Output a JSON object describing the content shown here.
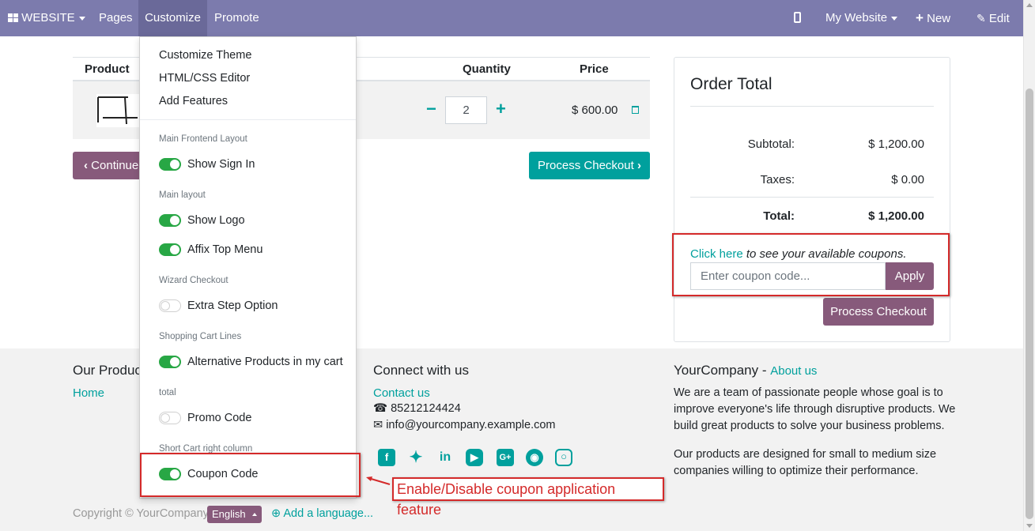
{
  "topbar": {
    "website_label": "WEBSITE",
    "pages": "Pages",
    "customize": "Customize",
    "promote": "Promote",
    "my_website": "My Website",
    "new": "New",
    "edit": "Edit",
    "bg_color": "#7c7bad"
  },
  "dropdown": {
    "items": [
      "Customize Theme",
      "HTML/CSS Editor",
      "Add Features"
    ],
    "sections": [
      {
        "header": "Main Frontend Layout",
        "options": [
          {
            "label": "Show Sign In",
            "enabled": true
          }
        ]
      },
      {
        "header": "Main layout",
        "options": [
          {
            "label": "Show Logo",
            "enabled": true
          },
          {
            "label": "Affix Top Menu",
            "enabled": true
          }
        ]
      },
      {
        "header": "Wizard Checkout",
        "options": [
          {
            "label": "Extra Step Option",
            "enabled": false
          }
        ]
      },
      {
        "header": "Shopping Cart Lines",
        "options": [
          {
            "label": "Alternative Products in my cart",
            "enabled": true
          }
        ]
      },
      {
        "header": "total",
        "options": [
          {
            "label": "Promo Code",
            "enabled": false
          }
        ]
      },
      {
        "header": "Short Cart right column",
        "options": [
          {
            "label": "Coupon Code",
            "enabled": true
          }
        ]
      }
    ]
  },
  "cart": {
    "headers": {
      "product": "Product",
      "quantity": "Quantity",
      "price": "Price"
    },
    "row": {
      "quantity": "2",
      "price": "$ 600.00"
    },
    "continue_label": "Continue",
    "checkout_label": "Process Checkout"
  },
  "order": {
    "title": "Order Total",
    "subtotal_label": "Subtotal:",
    "subtotal": "$ 1,200.00",
    "taxes_label": "Taxes:",
    "taxes": "$ 0.00",
    "total_label": "Total:",
    "total": "$ 1,200.00",
    "coupon_link": "Click here",
    "coupon_text": " to see your available coupons.",
    "coupon_placeholder": "Enter coupon code...",
    "apply_label": "Apply",
    "checkout_label": "Process Checkout"
  },
  "footer": {
    "products_title": "Our Produc",
    "home": "Home",
    "connect_title": "Connect with us",
    "contact": "Contact us",
    "phone": "85212124424",
    "email": "info@yourcompany.example.com",
    "company": "YourCompany",
    "about_sep": " - ",
    "about": "About us",
    "about_text1": "We are a team of passionate people whose goal is to improve everyone's life through disruptive products. We build great products to solve your business problems.",
    "about_text2": "Our products are designed for small to medium size companies willing to optimize their performance.",
    "copyright": "Copyright © YourCompany",
    "language": "English",
    "add_language": "Add a language..."
  },
  "annotation": {
    "text": "Enable/Disable coupon application feature",
    "color": "#d42a2a"
  },
  "colors": {
    "primary": "#00a09d",
    "secondary": "#875a7b",
    "toggle_on": "#28a745"
  }
}
